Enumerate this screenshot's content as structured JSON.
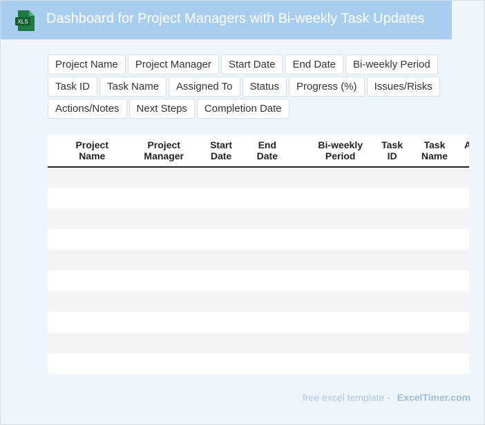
{
  "header": {
    "title": "Dashboard for Project Managers with Bi-weekly Task Updates",
    "icon_text": "XLS",
    "icon_color": "#1e7a45",
    "banner_color": "#a9cdef"
  },
  "fields": [
    "Project Name",
    "Project Manager",
    "Start Date",
    "End Date",
    "Bi-weekly Period",
    "Task ID",
    "Task Name",
    "Assigned To",
    "Status",
    "Progress (%)",
    "Issues/Risks",
    "Actions/Notes",
    "Next Steps",
    "Completion Date"
  ],
  "table": {
    "columns": [
      [
        "Project",
        "Name"
      ],
      [
        "Project",
        "Manager"
      ],
      [
        "Start",
        "Date"
      ],
      [
        "End",
        "Date"
      ],
      [
        "Bi-weekly",
        "Period"
      ],
      [
        "Task",
        "ID"
      ],
      [
        "Task",
        "Name"
      ],
      [
        "A",
        ""
      ]
    ]
  },
  "footer": {
    "prefix": "free excel template -",
    "brand": "ExcelTimer.com"
  }
}
